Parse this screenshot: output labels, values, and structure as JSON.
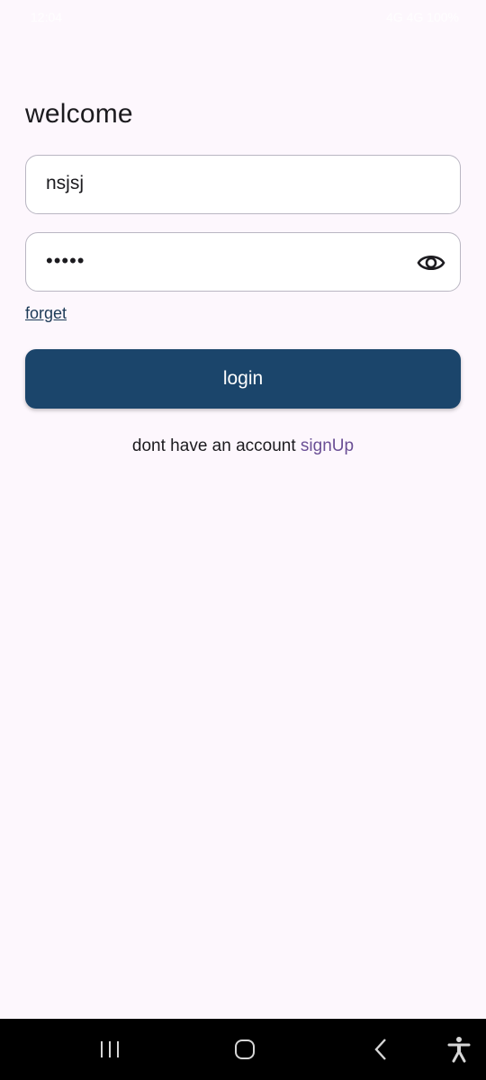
{
  "status_bar": {
    "time": "12:04",
    "right": "4G 4G 100%"
  },
  "header": {
    "title": "welcome"
  },
  "form": {
    "username_value": "nsjsj",
    "password_value": "•••••",
    "forget_label": "forget",
    "login_label": "login"
  },
  "signup": {
    "prompt": "dont have an account ",
    "link_label": "signUp"
  },
  "icons": {
    "password_toggle": "eye-icon",
    "nav_recents": "recents-icon",
    "nav_home": "home-icon",
    "nav_back": "back-icon",
    "nav_accessibility": "accessibility-icon"
  },
  "colors": {
    "background": "#fdf7fd",
    "primary_button": "#1b456b",
    "link_purple": "#6a4f95",
    "field_border": "#b9b6c2"
  }
}
